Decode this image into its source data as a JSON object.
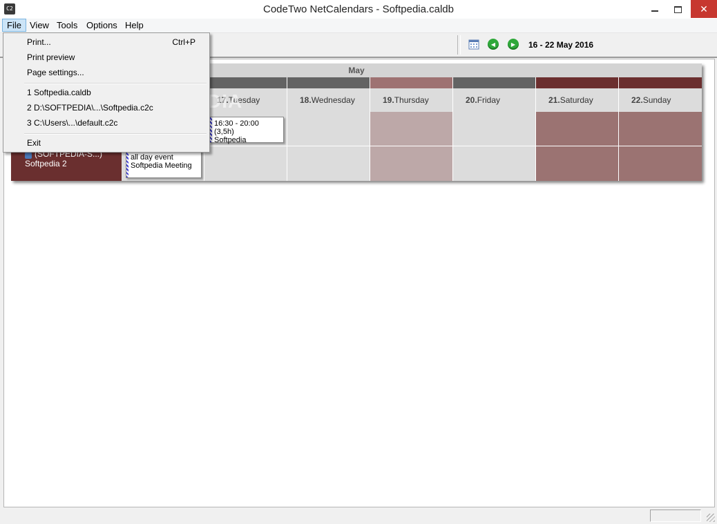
{
  "window": {
    "title": "CodeTwo NetCalendars - Softpedia.caldb",
    "icon_text": "C2",
    "close_glyph": "✕"
  },
  "menu": {
    "items": [
      "File",
      "View",
      "Tools",
      "Options",
      "Help"
    ],
    "active": "File"
  },
  "file_menu": {
    "items": [
      {
        "label": "Print...",
        "shortcut": "Ctrl+P"
      },
      {
        "label": "Print preview",
        "shortcut": ""
      },
      {
        "label": "Page settings...",
        "shortcut": ""
      },
      {
        "label": "1 Softpedia.caldb",
        "shortcut": ""
      },
      {
        "label": "2 D:\\SOFTPEDIA\\...\\Softpedia.c2c",
        "shortcut": ""
      },
      {
        "label": "3 C:\\Users\\...\\default.c2c",
        "shortcut": ""
      },
      {
        "label": "Exit",
        "shortcut": ""
      }
    ]
  },
  "toolbar": {
    "date_range": "16 - 22 May 2016",
    "prev_glyph": "◀",
    "next_glyph": "▶"
  },
  "calendar": {
    "month": "May",
    "days": [
      {
        "num": "17.",
        "name": "Tuesday",
        "weekend": false
      },
      {
        "num": "18.",
        "name": "Wednesday",
        "weekend": false
      },
      {
        "num": "19.",
        "name": "Thursday",
        "weekend": false
      },
      {
        "num": "20.",
        "name": "Friday",
        "weekend": false
      },
      {
        "num": "21.",
        "name": "Saturday",
        "weekend": true
      },
      {
        "num": "22.",
        "name": "Sunday",
        "weekend": true
      }
    ],
    "rows": [
      {
        "user_line1": "(SOFTPEDIA-S...)",
        "user_line2": "Softpedia 2"
      }
    ],
    "events": [
      {
        "line1": "16:30 - 20:00 (3,5h)",
        "line2": "Softpedia"
      },
      {
        "line1": "all day event",
        "line2": "Softpedia Meeting"
      }
    ]
  },
  "watermark": "SOFTPEDIA",
  "colors": {
    "weekday_header": "#636363",
    "thursday_header": "#9e7272",
    "weekend_header": "#6b2f2f",
    "weekday_cell": "#dcdcdc",
    "thursday_cell": "#bda8a8",
    "weekend_cell": "#9b7372"
  }
}
